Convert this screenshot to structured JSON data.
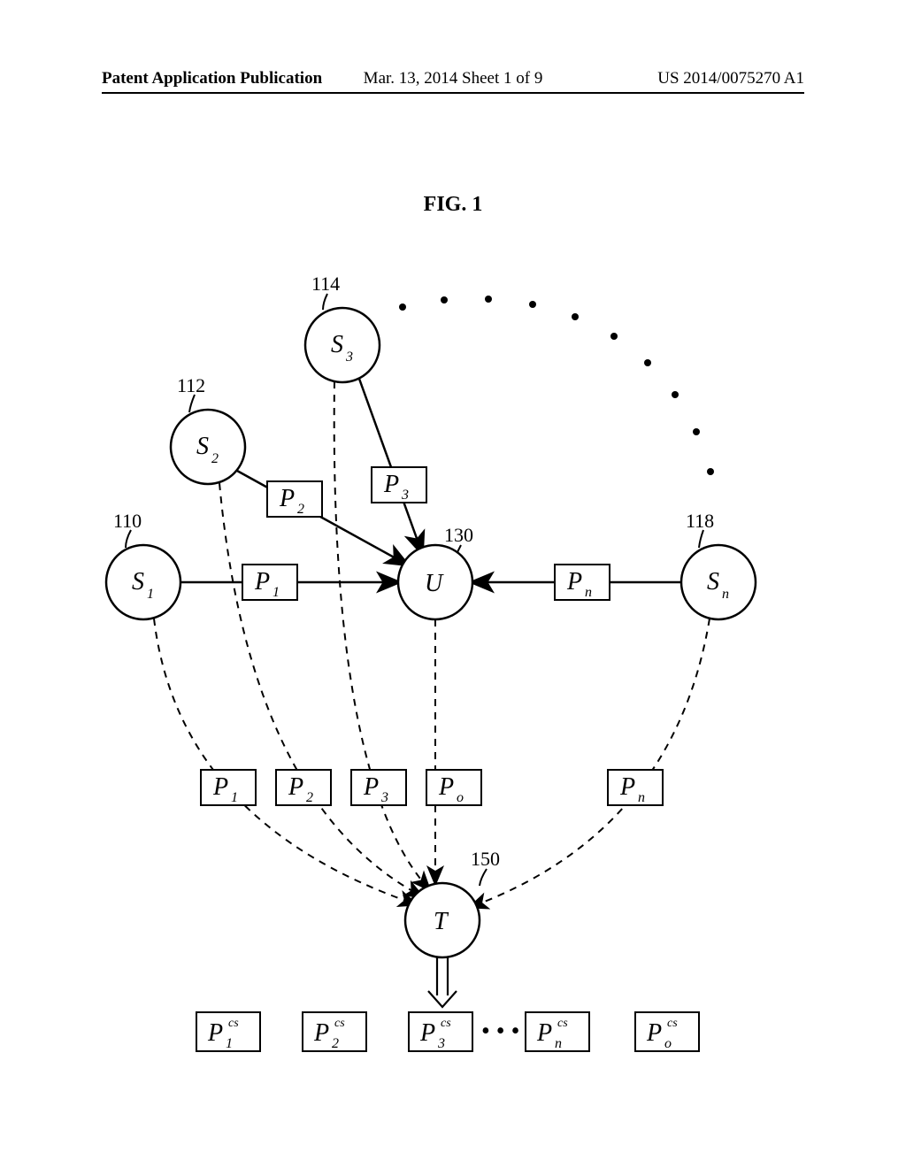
{
  "header": {
    "left": "Patent Application Publication",
    "center": "Mar. 13, 2014  Sheet 1 of 9",
    "right": "US 2014/0075270 A1"
  },
  "figure": {
    "title": "FIG. 1",
    "refs": {
      "r110": "110",
      "r112": "112",
      "r114": "114",
      "r118": "118",
      "r130": "130",
      "r150": "150"
    },
    "nodes": {
      "s1": {
        "main": "S",
        "sub": "1"
      },
      "s2": {
        "main": "S",
        "sub": "2"
      },
      "s3": {
        "main": "S",
        "sub": "3"
      },
      "sn": {
        "main": "S",
        "sub": "n"
      },
      "u": {
        "main": "U",
        "sub": ""
      },
      "t": {
        "main": "T",
        "sub": ""
      }
    },
    "p_upper": {
      "p1": {
        "main": "P",
        "sub": "1"
      },
      "p2": {
        "main": "P",
        "sub": "2"
      },
      "p3": {
        "main": "P",
        "sub": "3"
      },
      "pn": {
        "main": "P",
        "sub": "n"
      }
    },
    "p_mid": {
      "p1": {
        "main": "P",
        "sub": "1"
      },
      "p2": {
        "main": "P",
        "sub": "2"
      },
      "p3": {
        "main": "P",
        "sub": "3"
      },
      "po": {
        "main": "P",
        "sub": "o"
      },
      "pn": {
        "main": "P",
        "sub": "n"
      }
    },
    "p_out": {
      "p1": {
        "main": "P",
        "sub": "1",
        "sup": "cs"
      },
      "p2": {
        "main": "P",
        "sub": "2",
        "sup": "cs"
      },
      "p3": {
        "main": "P",
        "sub": "3",
        "sup": "cs"
      },
      "pn": {
        "main": "P",
        "sub": "n",
        "sup": "cs"
      },
      "po": {
        "main": "P",
        "sub": "o",
        "sup": "cs"
      }
    },
    "ellipsis": "• • •"
  }
}
